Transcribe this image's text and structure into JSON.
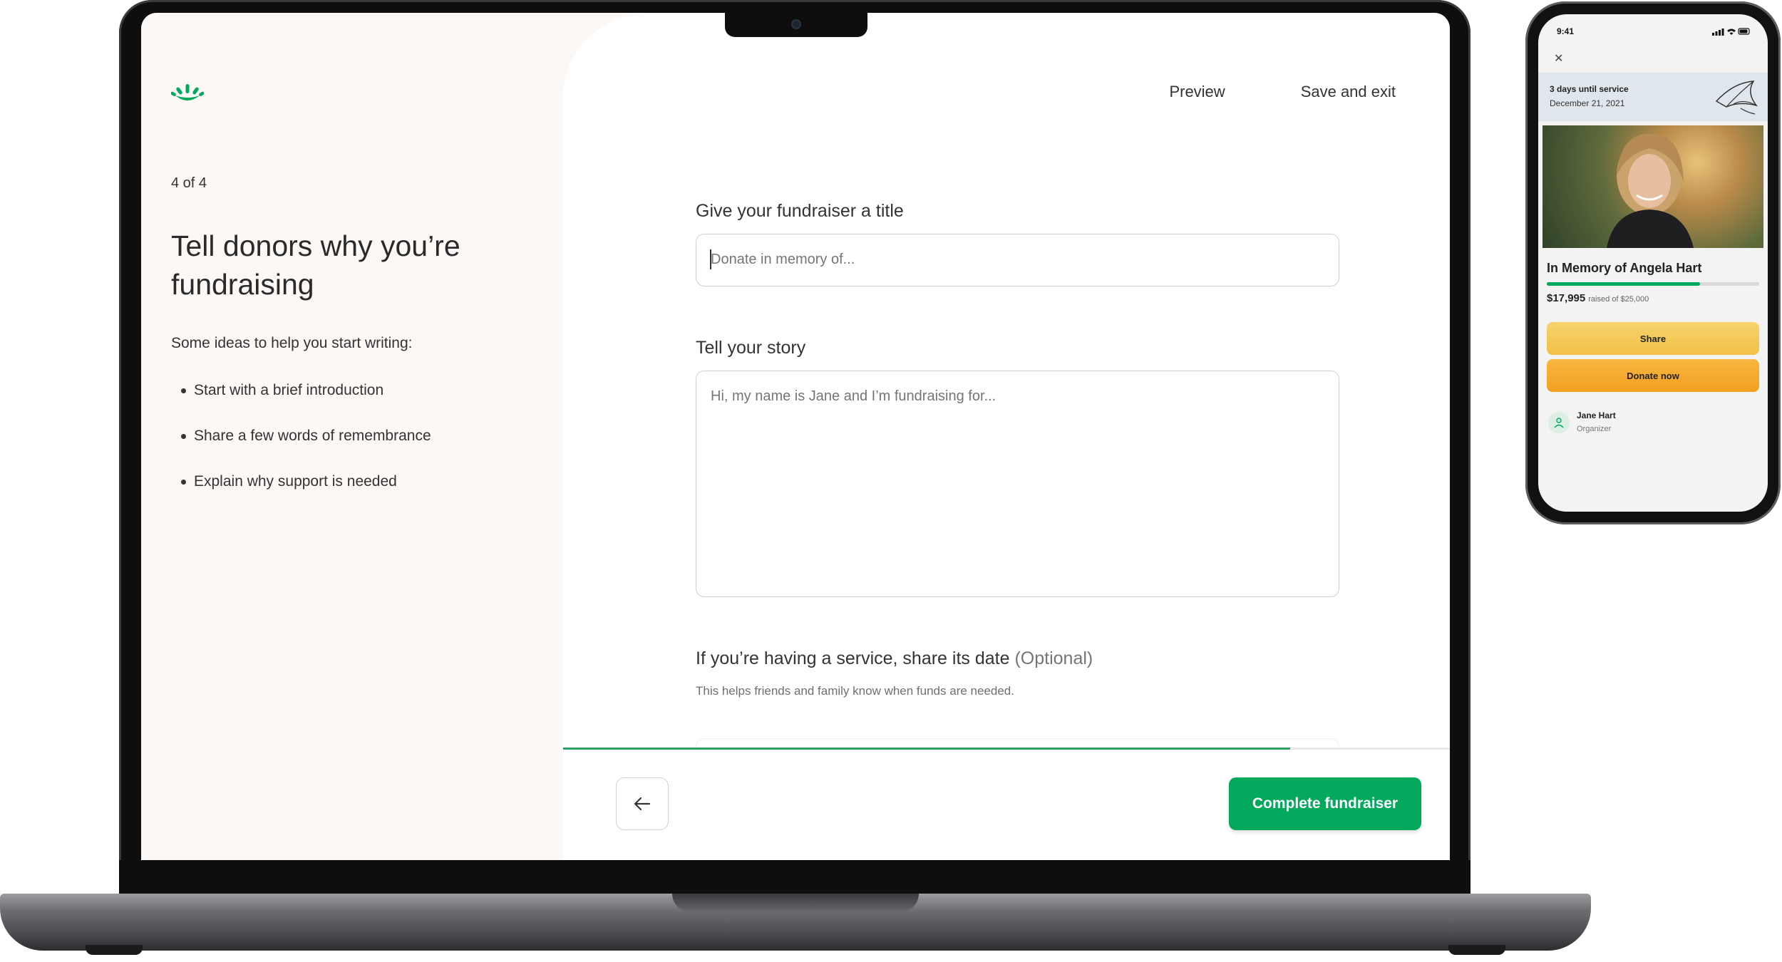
{
  "colors": {
    "brand_green": "#02a95c",
    "left_panel_bg": "#fbf8f6",
    "share_yellow": "#f3c84f",
    "donate_orange": "#f5a92c"
  },
  "left": {
    "step": "4 of 4",
    "headline": "Tell donors why you’re fundraising",
    "ideas_intro": "Some ideas to help you start writing:",
    "ideas": [
      "Start with a brief introduction",
      "Share a few words of remembrance",
      "Explain why support is needed"
    ]
  },
  "header": {
    "preview": "Preview",
    "save_exit": "Save and exit"
  },
  "form": {
    "title_label": "Give your fundraiser a title",
    "title_placeholder": "Donate in memory of...",
    "story_label": "Tell your story",
    "story_placeholder": "Hi, my name is Jane and I’m fundraising for...",
    "service_label": "If you’re having a service, share its date",
    "service_optional": "(Optional)",
    "service_help": "This helps friends and family know when funds are needed."
  },
  "footer": {
    "progress_fraction": 0.82,
    "back_icon": "arrow-left-icon",
    "complete_label": "Complete fundraiser"
  },
  "phone": {
    "time": "9:41",
    "banner_title": "3 days until service",
    "banner_date": "December 21, 2021",
    "fundraiser_title": "In Memory of Angela Hart",
    "raised_amount": "$17,995",
    "raised_of": "raised of $25,000",
    "progress_fraction": 0.72,
    "share_label": "Share",
    "donate_label": "Donate now",
    "organizer_name": "Jane Hart",
    "organizer_role": "Organizer"
  }
}
